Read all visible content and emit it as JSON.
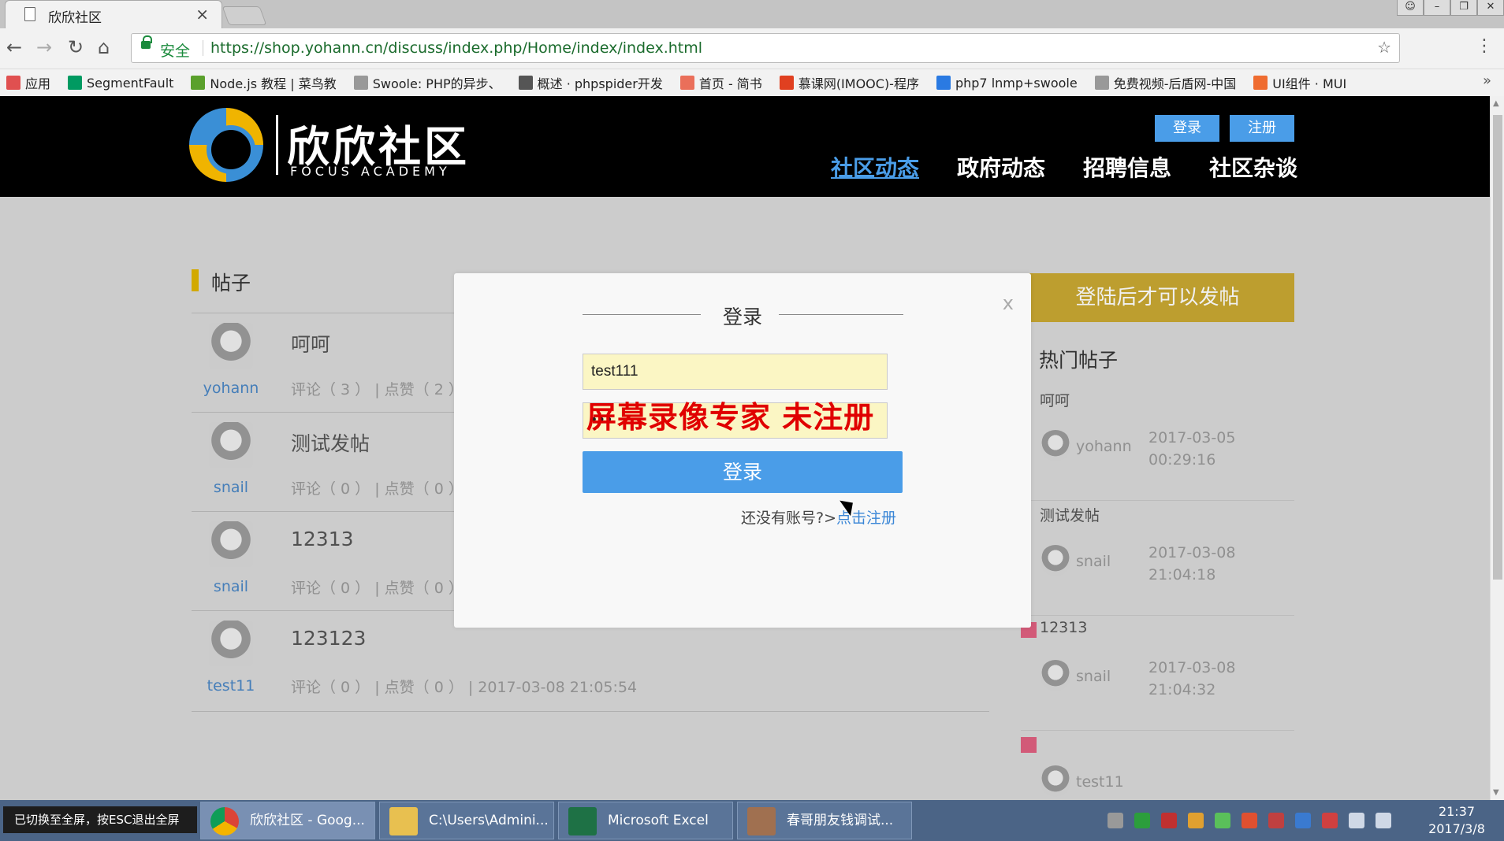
{
  "browser": {
    "tab_title": "欣欣社区",
    "tab_close": "×",
    "secure_label": "安全",
    "url": "https://shop.yohann.cn/discuss/index.php/Home/index/index.html",
    "bookmarks": [
      {
        "label": "应用",
        "color": "#e05050"
      },
      {
        "label": "SegmentFault",
        "color": "#009a61"
      },
      {
        "label": "Node.js 教程 | 菜鸟教",
        "color": "#5aa02c"
      },
      {
        "label": "Swoole: PHP的异步、",
        "color": "#999999"
      },
      {
        "label": "概述 · phpspider开发",
        "color": "#555555"
      },
      {
        "label": "首页 - 简书",
        "color": "#ea6f5a"
      },
      {
        "label": "慕课网(IMOOC)-程序",
        "color": "#e04020"
      },
      {
        "label": "php7 lnmp+swoole",
        "color": "#2a7ae2"
      },
      {
        "label": "免费视频-后盾网-中国",
        "color": "#999999"
      },
      {
        "label": "UI组件 · MUI",
        "color": "#ef6c30"
      }
    ],
    "bookmarks_more": "»"
  },
  "site": {
    "logo_cn": "欣欣社区",
    "logo_en": "FOCUS ACADEMY",
    "login_btn": "登录",
    "register_btn": "注册",
    "nav": [
      "社区动态",
      "政府动态",
      "招聘信息",
      "社区杂谈"
    ],
    "accent_color": "#4a9de8"
  },
  "posts": {
    "heading": "帖子",
    "items": [
      {
        "author": "yohann",
        "title": "呵呵",
        "meta": "评论（ 3 ）  |  点赞（ 2 ）"
      },
      {
        "author": "snail",
        "title": "测试发帖",
        "meta": "评论（ 0 ）  |  点赞（ 0 ）"
      },
      {
        "author": "snail",
        "title": "12313",
        "meta": "评论（ 0 ）  |  点赞（ 0 ）"
      },
      {
        "author": "test11",
        "title": "123123",
        "meta": "评论（ 0 ）  |  点赞（ 0 ）  |  2017-03-08 21:05:54"
      }
    ]
  },
  "sidebar": {
    "banner": "登陆后才可以发帖",
    "hot_heading": "热门帖子",
    "hot": [
      {
        "title": "呵呵",
        "author": "yohann",
        "date": "2017-03-05",
        "time": "00:29:16"
      },
      {
        "title": "测试发帖",
        "author": "snail",
        "date": "2017-03-08",
        "time": "21:04:18"
      },
      {
        "title": "12313",
        "author": "snail",
        "date": "2017-03-08",
        "time": "21:04:32"
      },
      {
        "title": "",
        "author": "test11",
        "date": "",
        "time": ""
      }
    ]
  },
  "modal": {
    "title": "登录",
    "close": "x",
    "username_value": "test111",
    "password_value": "•••",
    "watermark": "屏幕录像专家  未注册",
    "submit": "登录",
    "register_hint": "还没有账号?>",
    "register_link": "点击注册"
  },
  "taskbar": {
    "esc_tip": "已切换至全屏，按ESC退出全屏",
    "tasks": [
      "欣欣社区 - Goog...",
      "C:\\Users\\Admini...",
      "Microsoft Excel",
      "春哥朋友钱调试..."
    ],
    "clock_time": "21:37",
    "clock_date": "2017/3/8"
  }
}
